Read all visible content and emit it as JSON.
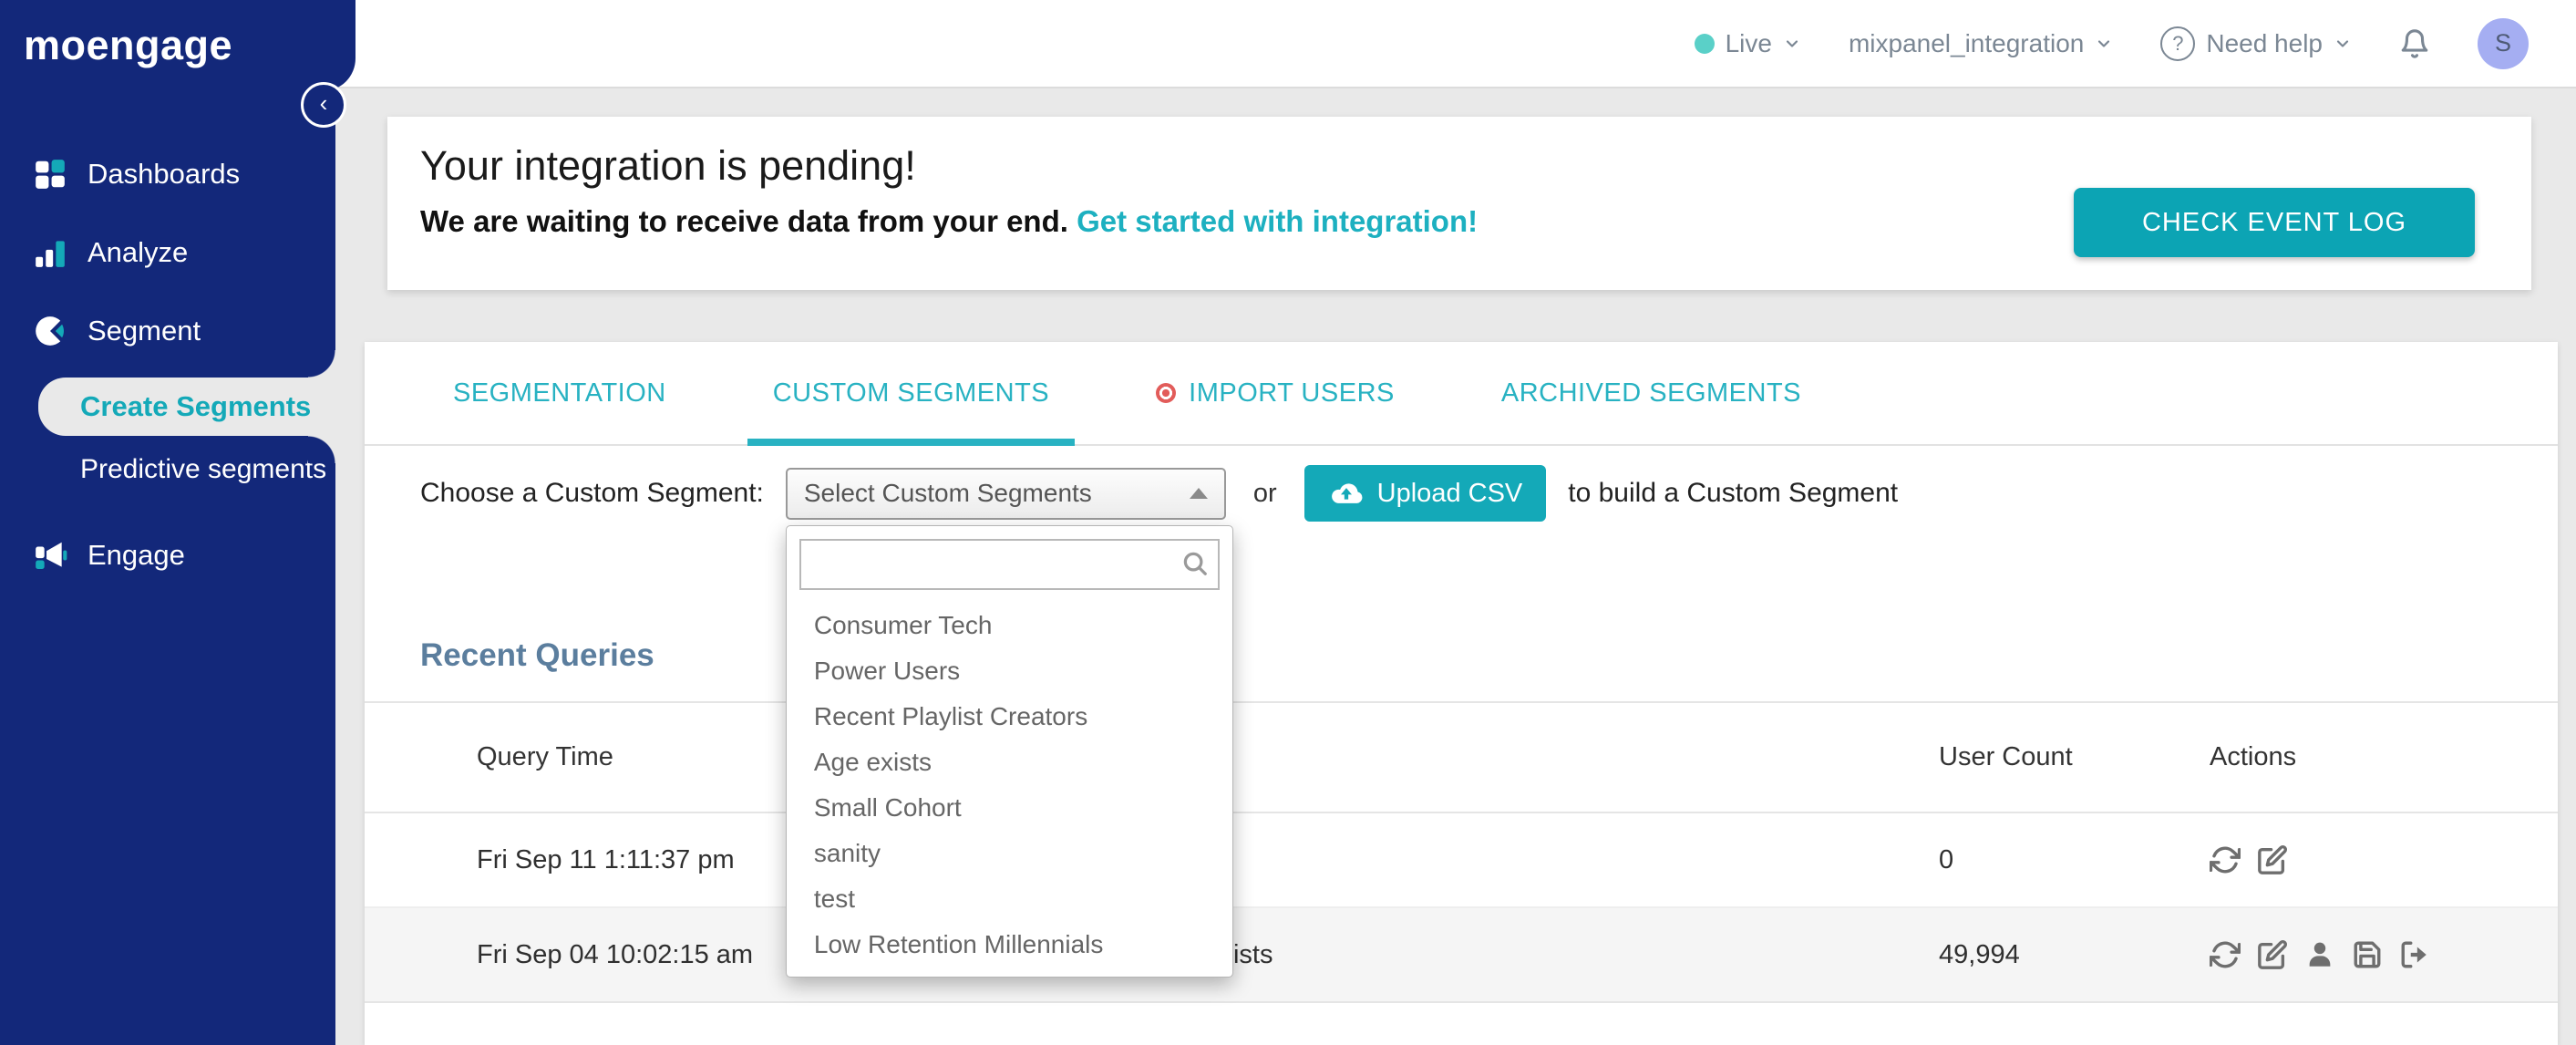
{
  "colors": {
    "accent_teal": "#14a9b8",
    "tab_teal": "#28b2c2",
    "sidebar_navy": "#13287a",
    "page_bg": "#e9e9e9",
    "import_dot_red": "#e25c5a",
    "avatar_bg": "#a5aef2",
    "live_dot": "#5ad0c8",
    "heading_slate": "#5b7e9e"
  },
  "sidebar": {
    "logo": "moengage",
    "items": [
      {
        "label": "Dashboards",
        "icon": "grid-icon"
      },
      {
        "label": "Analyze",
        "icon": "bar-chart-icon"
      },
      {
        "label": "Segment",
        "icon": "pie-chart-icon"
      },
      {
        "label": "Engage",
        "icon": "megaphone-icon"
      }
    ],
    "segment_children": [
      {
        "label": "Create Segments",
        "active": true
      },
      {
        "label": "Predictive segments",
        "active": false
      }
    ]
  },
  "header": {
    "environment": "Live",
    "workspace": "mixpanel_integration",
    "help": "Need help",
    "avatar_initial": "S"
  },
  "banner": {
    "title": "Your integration is pending!",
    "message": "We are waiting to receive data from your end.",
    "link": "Get started with integration!",
    "button": "CHECK EVENT LOG"
  },
  "tabs": [
    {
      "label": "SEGMENTATION",
      "active": false
    },
    {
      "label": "CUSTOM SEGMENTS",
      "active": true
    },
    {
      "label": "IMPORT USERS",
      "active": false,
      "dot": true
    },
    {
      "label": "ARCHIVED SEGMENTS",
      "active": false
    }
  ],
  "picker": {
    "label": "Choose a Custom Segment:",
    "select_value": "Select Custom Segments",
    "or_text": "or",
    "upload_button": "Upload CSV",
    "suffix_text": "to build a Custom Segment",
    "search_value": "",
    "options": [
      "Consumer Tech",
      "Power Users",
      "Recent Playlist Creators",
      "Age exists",
      "Small Cohort",
      "sanity",
      "test",
      "Low Retention Millennials"
    ]
  },
  "recent": {
    "title": "Recent Queries",
    "columns": {
      "time": "Query Time",
      "count": "User Count",
      "actions": "Actions"
    },
    "rows": [
      {
        "time": "Fri Sep 11 1:11:37 pm",
        "query": "",
        "count": "0"
      },
      {
        "time": "Fri Sep 04 10:02:15 am",
        "query": "Users in custom segment: Age exists",
        "count": "49,994"
      }
    ]
  }
}
